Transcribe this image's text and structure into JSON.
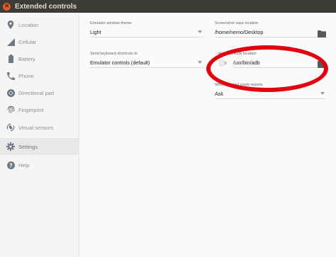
{
  "window": {
    "title": "Extended controls"
  },
  "sidebar": {
    "items": [
      {
        "label": "Location",
        "icon": "location-pin-icon"
      },
      {
        "label": "Cellular",
        "icon": "signal-bars-icon"
      },
      {
        "label": "Battery",
        "icon": "battery-icon"
      },
      {
        "label": "Phone",
        "icon": "phone-icon"
      },
      {
        "label": "Directional pad",
        "icon": "dpad-icon"
      },
      {
        "label": "Fingerprint",
        "icon": "fingerprint-icon"
      },
      {
        "label": "Virtual sensors",
        "icon": "rotate-icon"
      },
      {
        "label": "Settings",
        "icon": "gear-icon",
        "active": true
      },
      {
        "label": "Help",
        "icon": "help-icon"
      }
    ]
  },
  "settings": {
    "theme": {
      "label": "Emulator window theme",
      "value": "Light"
    },
    "shortcuts": {
      "label": "Send keyboard shortcuts to",
      "value": "Emulator controls (default)"
    },
    "screenshot": {
      "label": "Screenshot save location",
      "value": "/home/nemo/Desktop"
    },
    "adb": {
      "label": "Use detected ADB location",
      "label_visible": "...detected ADB location",
      "value": "/usr/bin/adb",
      "toggle": "off"
    },
    "crash": {
      "label": "When to send crash reports",
      "value": "Ask"
    }
  },
  "colors": {
    "accent_red": "#e3000f",
    "titlebar": "#3c3b37",
    "close_button": "#e05a2a"
  }
}
